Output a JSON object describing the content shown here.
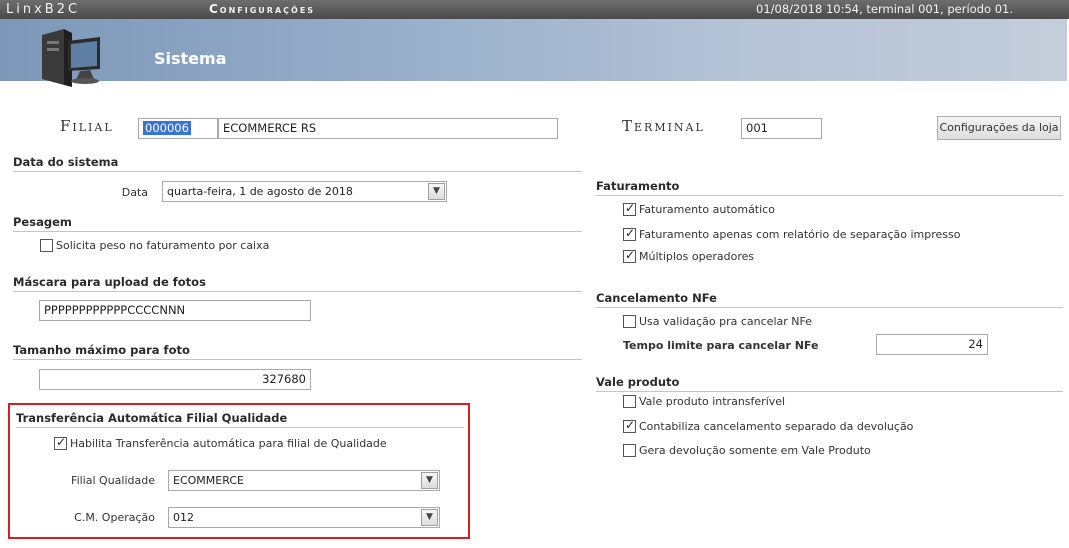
{
  "topbar": {
    "brand": "LinxB2C",
    "module": "Configurações",
    "session": "01/08/2018 10:54, terminal 001, período 01."
  },
  "header": {
    "title": "Sistema",
    "icon": "computer-icon"
  },
  "filial": {
    "label": "Filial",
    "code": "000006",
    "name": "ECOMMERCE RS"
  },
  "terminal": {
    "label": "Terminal",
    "value": "001",
    "button": "Configurações da loja"
  },
  "data_sistema": {
    "section": "Data do sistema",
    "label": "Data",
    "value": "quarta-feira, 1 de agosto de 2018"
  },
  "pesagem": {
    "section": "Pesagem",
    "checkbox_label": "Solicita peso no faturamento por caixa",
    "checked": false
  },
  "mascara": {
    "section": "Máscara para upload de fotos",
    "value": "PPPPPPPPPPPPCCCCNNN"
  },
  "tamanho": {
    "section": "Tamanho máximo para foto",
    "value": "327680"
  },
  "transferencia": {
    "section": "Transferência Automática Filial Qualidade",
    "checkbox_label": "Habilita Transferência automática para filial de Qualidade",
    "checked": true,
    "filial_label": "Filial Qualidade",
    "filial_value": "ECOMMERCE",
    "operacao_label": "C.M. Operação",
    "operacao_value": "012"
  },
  "faturamento": {
    "section": "Faturamento",
    "items": [
      {
        "label": "Faturamento automático",
        "checked": true
      },
      {
        "label": "Faturamento apenas com relatório de separação impresso",
        "checked": true
      },
      {
        "label": "Múltiplos operadores",
        "checked": true
      }
    ]
  },
  "cancelamento": {
    "section": "Cancelamento NFe",
    "checkbox_label": "Usa validação pra cancelar NFe",
    "checked": false,
    "tempo_label": "Tempo limite para cancelar NFe",
    "tempo_value": "24"
  },
  "vale": {
    "section": "Vale produto",
    "items": [
      {
        "label": "Vale produto intransferível",
        "checked": false
      },
      {
        "label": "Contabiliza cancelamento separado da devolução",
        "checked": true
      },
      {
        "label": "Gera devolução somente em Vale Produto",
        "checked": false
      }
    ]
  },
  "colors": {
    "highlight_box": "#d32027",
    "selection": "#3874d8"
  }
}
